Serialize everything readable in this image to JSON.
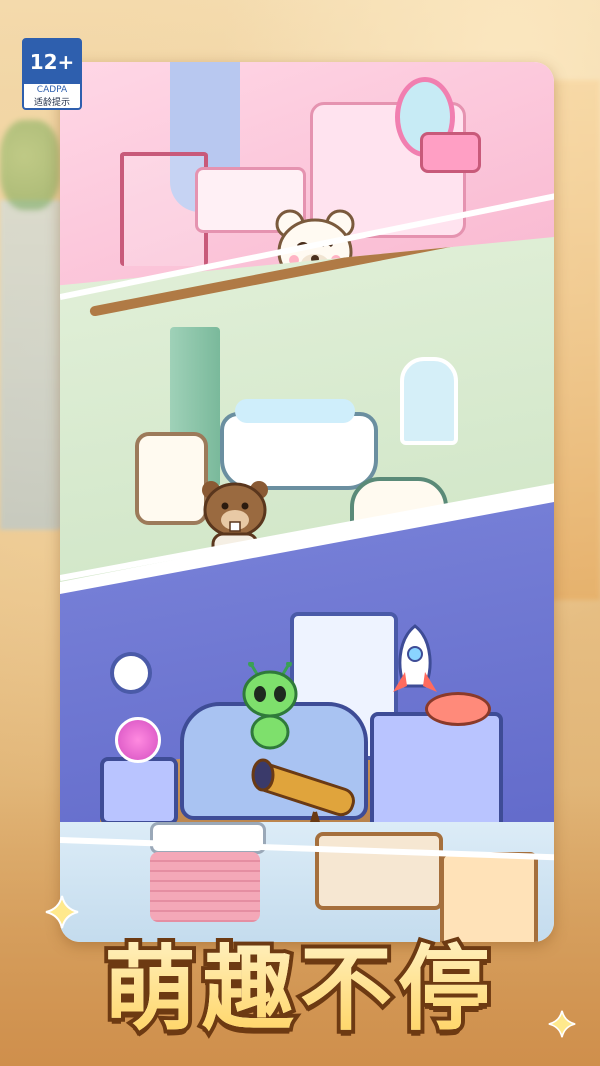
{
  "rating_badge": {
    "age": "12+",
    "org": "CADPA",
    "label": "适龄提示"
  },
  "slogan": "萌趣不停",
  "colors": {
    "badge_blue": "#2e5fae",
    "slogan_fill": "#ffd25c",
    "slogan_outline": "#6d3a12",
    "pink_room": "#f7b2cc",
    "green_room": "#cfe5c6",
    "blue_room": "#5f67c8"
  },
  "icons": [
    "sparkle-icon",
    "bear-icon",
    "beaver-icon",
    "alien-icon",
    "rocket-icon",
    "telescope-icon"
  ]
}
